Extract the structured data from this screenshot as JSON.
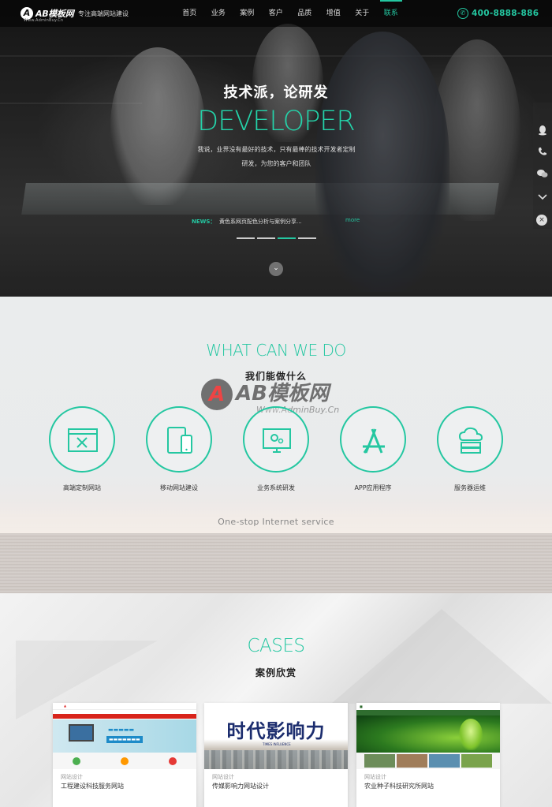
{
  "header": {
    "logo_text": "AB模板网",
    "logo_sub": "Www.AdminBuy.Cn",
    "slogan": "专注高端网站建设",
    "menu": [
      {
        "label": "首页",
        "active": false
      },
      {
        "label": "业务",
        "active": false
      },
      {
        "label": "案例",
        "active": false
      },
      {
        "label": "客户",
        "active": false
      },
      {
        "label": "品质",
        "active": false
      },
      {
        "label": "增值",
        "active": false
      },
      {
        "label": "关于",
        "active": false
      },
      {
        "label": "联系",
        "active": true
      }
    ],
    "phone": "400-8888-886"
  },
  "hero": {
    "title": "技术派，论研发",
    "big_text": "DEVELOPER",
    "description": "我说，业界没有最好的技术，只有最棒的技术开发者定制研发，为您的客户和团队",
    "news_label": "NEWS：",
    "news_text": "黄色系网页配色分析与案例分享...",
    "news_more": "more",
    "slides": [
      false,
      false,
      true,
      false
    ]
  },
  "sidebar": {
    "icons": [
      "qq-icon",
      "phone-icon",
      "wechat-icon",
      "chevron-down-icon"
    ],
    "close": "×"
  },
  "services": {
    "title_en": "WHAT CAN WE DO",
    "title_cn": "我们能做什么",
    "items": [
      {
        "label": "高端定制网站",
        "icon": "web-design-icon"
      },
      {
        "label": "移动网站建设",
        "icon": "mobile-icon"
      },
      {
        "label": "业务系统研发",
        "icon": "system-dev-icon"
      },
      {
        "label": "APP应用程序",
        "icon": "app-store-icon"
      },
      {
        "label": "服务器运维",
        "icon": "cloud-server-icon"
      }
    ],
    "footer": "One-stop Internet service",
    "watermark_text": "AB模板网",
    "watermark_url": "Www.AdminBuy.Cn"
  },
  "cases": {
    "title_en": "CASES",
    "title_cn": "案例欣赏",
    "items": [
      {
        "meta": "网站设计",
        "name": "工程建设科技服务网站"
      },
      {
        "meta": "网站设计",
        "name": "传媒影响力网站设计"
      },
      {
        "meta": "网站设计",
        "name": "农业种子科技研究所网站"
      }
    ],
    "thumb2_big": "时代影响力",
    "thumb2_sub": "TIMES INFLUENCE"
  },
  "colors": {
    "accent": "#24c7a1",
    "nav_background": "#000000",
    "services_background": "#eaeced"
  }
}
